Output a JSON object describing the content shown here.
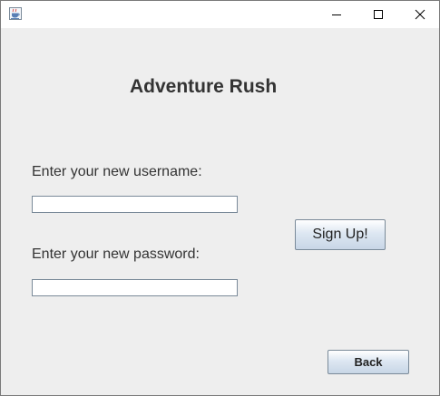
{
  "window": {
    "app_icon": "java-cup-icon",
    "controls": {
      "minimize_icon": "minimize-icon",
      "maximize_icon": "maximize-icon",
      "close_icon": "close-icon"
    }
  },
  "form": {
    "title": "Adventure Rush",
    "username_label": "Enter your new username:",
    "username_value": "",
    "password_label": "Enter your new password:",
    "password_value": "",
    "signup_label": "Sign Up!",
    "back_label": "Back"
  }
}
